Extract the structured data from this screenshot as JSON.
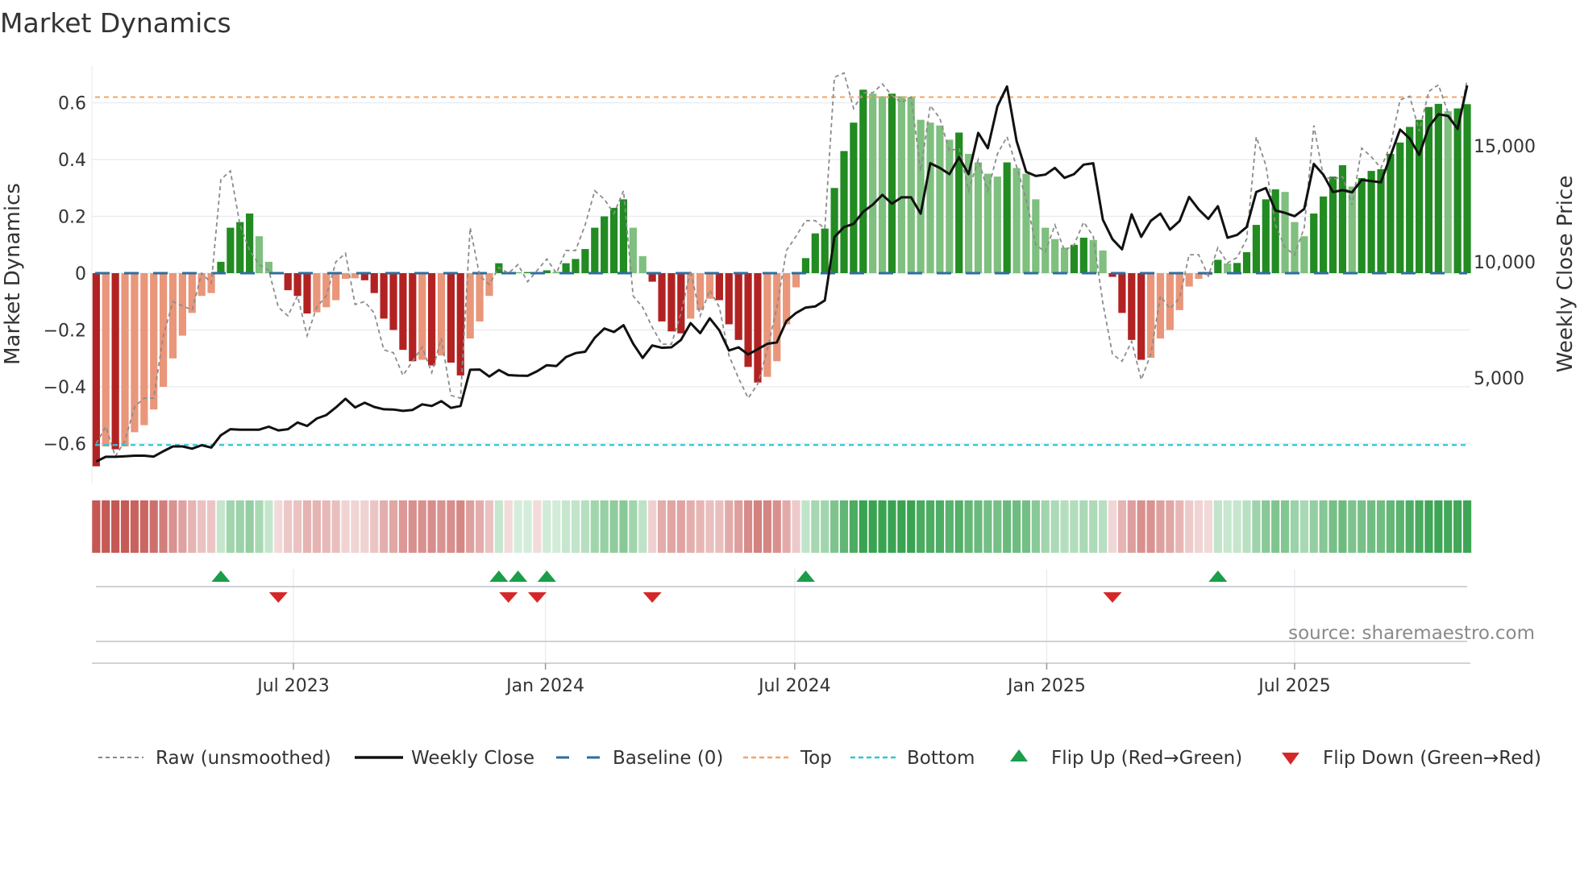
{
  "chart_data": {
    "type": "bar",
    "title": "Market Dynamics",
    "ylabel": "Market Dynamics",
    "y2label": "Weekly Close Price",
    "source": "source: sharemaestro.com",
    "frequency": "weekly",
    "start_week": "2023-02-07",
    "ylim": [
      -0.72,
      0.72
    ],
    "y2lim": [
      0,
      18500
    ],
    "grid": true,
    "legend_position": "bottom",
    "top_level": 0.62,
    "bottom_level": -0.605,
    "baseline_level": 0,
    "y_ticks": [
      {
        "value": 0.6,
        "label": "0.6"
      },
      {
        "value": 0.4,
        "label": "0.4"
      },
      {
        "value": 0.2,
        "label": "0.2"
      },
      {
        "value": 0,
        "label": "0"
      },
      {
        "value": -0.2,
        "label": "−0.2"
      },
      {
        "value": -0.4,
        "label": "−0.4"
      },
      {
        "value": -0.6,
        "label": "−0.6"
      }
    ],
    "y2_ticks": [
      {
        "value": 15000,
        "label": "15,000"
      },
      {
        "value": 10000,
        "label": "10,000"
      },
      {
        "value": 5000,
        "label": "5,000"
      }
    ],
    "x_ticks": [
      {
        "date": "2023-07-01",
        "label": "Jul 2023"
      },
      {
        "date": "2024-01-01",
        "label": "Jan 2024"
      },
      {
        "date": "2024-07-01",
        "label": "Jul 2024"
      },
      {
        "date": "2025-01-01",
        "label": "Jan 2025"
      },
      {
        "date": "2025-07-01",
        "label": "Jul 2025"
      }
    ],
    "legend": [
      {
        "label": "Raw (unsmoothed)",
        "color": "#888888"
      },
      {
        "label": "Weekly Close",
        "color": "#111111"
      },
      {
        "label": "Baseline (0)",
        "color": "#2e6e9e"
      },
      {
        "label": "Top",
        "color": "#f0a56a"
      },
      {
        "label": "Bottom",
        "color": "#2ec7d6"
      },
      {
        "label": "Flip Up (Red→Green)",
        "color": "#1a9e4a"
      },
      {
        "label": "Flip Down (Green→Red)",
        "color": "#d62728"
      }
    ],
    "colors": {
      "strong_pos": "#228b22",
      "weak_pos": "#7fbf7f",
      "strong_neg": "#b22222",
      "weak_neg": "#e9967a"
    },
    "flip_up_weeks": [
      14,
      43,
      45,
      48,
      75,
      118
    ],
    "flip_down_weeks": [
      20,
      44,
      47,
      59,
      107
    ],
    "momentum": [
      -0.68,
      -0.61,
      -0.62,
      -0.61,
      -0.56,
      -0.535,
      -0.48,
      -0.4,
      -0.3,
      -0.22,
      -0.14,
      -0.08,
      -0.07,
      0.04,
      0.16,
      0.18,
      0.21,
      0.13,
      0.04,
      -0.003,
      -0.06,
      -0.08,
      -0.142,
      -0.138,
      -0.12,
      -0.095,
      -0.02,
      -0.018,
      -0.025,
      -0.07,
      -0.16,
      -0.2,
      -0.27,
      -0.31,
      -0.305,
      -0.325,
      -0.29,
      -0.315,
      -0.36,
      -0.23,
      -0.17,
      -0.08,
      0.035,
      -0.002,
      0.002,
      0.004,
      -0.002,
      0.01,
      0.005,
      0.035,
      0.05,
      0.085,
      0.16,
      0.2,
      0.23,
      0.26,
      0.16,
      0.06,
      -0.03,
      -0.17,
      -0.205,
      -0.212,
      -0.16,
      -0.13,
      -0.09,
      -0.095,
      -0.18,
      -0.235,
      -0.33,
      -0.385,
      -0.365,
      -0.31,
      -0.18,
      -0.05,
      0.053,
      0.14,
      0.157,
      0.3,
      0.43,
      0.53,
      0.646,
      0.632,
      0.623,
      0.632,
      0.623,
      0.62,
      0.54,
      0.53,
      0.52,
      0.47,
      0.495,
      0.42,
      0.39,
      0.35,
      0.34,
      0.39,
      0.37,
      0.35,
      0.26,
      0.16,
      0.12,
      0.09,
      0.1,
      0.125,
      0.117,
      0.08,
      -0.013,
      -0.14,
      -0.235,
      -0.305,
      -0.298,
      -0.23,
      -0.2,
      -0.13,
      -0.047,
      -0.02,
      -0.007,
      0.047,
      0.034,
      0.036,
      0.074,
      0.17,
      0.26,
      0.295,
      0.286,
      0.18,
      0.13,
      0.21,
      0.27,
      0.34,
      0.38,
      0.305,
      0.335,
      0.36,
      0.366,
      0.42,
      0.46,
      0.515,
      0.54,
      0.585,
      0.596,
      0.57,
      0.58,
      0.595
    ],
    "raw": [
      -0.6,
      -0.54,
      -0.645,
      -0.59,
      -0.47,
      -0.44,
      -0.44,
      -0.22,
      -0.1,
      -0.115,
      -0.13,
      0.0,
      -0.035,
      0.33,
      0.36,
      0.17,
      0.08,
      0.03,
      0.01,
      -0.12,
      -0.15,
      -0.08,
      -0.22,
      -0.12,
      -0.08,
      0.04,
      0.07,
      -0.11,
      -0.1,
      -0.14,
      -0.27,
      -0.28,
      -0.36,
      -0.31,
      -0.26,
      -0.35,
      -0.23,
      -0.43,
      -0.44,
      0.16,
      -0.01,
      -0.04,
      0.02,
      0.0,
      0.03,
      -0.03,
      0.01,
      0.05,
      0.0,
      0.08,
      0.08,
      0.17,
      0.29,
      0.26,
      0.21,
      0.29,
      -0.08,
      -0.12,
      -0.19,
      -0.25,
      -0.25,
      -0.14,
      0.01,
      -0.15,
      -0.06,
      -0.12,
      -0.29,
      -0.37,
      -0.44,
      -0.39,
      -0.27,
      -0.12,
      0.08,
      0.13,
      0.185,
      0.185,
      0.157,
      0.69,
      0.705,
      0.58,
      0.635,
      0.635,
      0.666,
      0.625,
      0.6,
      0.62,
      0.36,
      0.59,
      0.545,
      0.43,
      0.44,
      0.29,
      0.4,
      0.29,
      0.42,
      0.48,
      0.375,
      0.26,
      0.1,
      0.075,
      0.17,
      0.08,
      0.1,
      0.18,
      0.13,
      -0.105,
      -0.285,
      -0.31,
      -0.24,
      -0.375,
      -0.285,
      -0.08,
      -0.125,
      -0.087,
      0.065,
      0.065,
      -0.01,
      0.09,
      0.036,
      0.055,
      0.12,
      0.48,
      0.38,
      0.17,
      0.09,
      0.064,
      0.16,
      0.52,
      0.34,
      0.33,
      0.34,
      0.24,
      0.44,
      0.41,
      0.37,
      0.45,
      0.61,
      0.623,
      0.5,
      0.64,
      0.663,
      0.565,
      0.51,
      0.68
    ],
    "weekly_close": [
      1400,
      1600,
      1600,
      1620,
      1650,
      1650,
      1610,
      1840,
      2050,
      2050,
      1950,
      2100,
      2000,
      2530,
      2790,
      2770,
      2770,
      2770,
      2900,
      2740,
      2790,
      3080,
      2930,
      3250,
      3400,
      3730,
      4100,
      3730,
      3930,
      3750,
      3650,
      3640,
      3580,
      3620,
      3860,
      3790,
      4000,
      3710,
      3790,
      5350,
      5360,
      5060,
      5340,
      5120,
      5100,
      5090,
      5290,
      5550,
      5510,
      5900,
      6070,
      6130,
      6730,
      7130,
      6980,
      7270,
      6480,
      5860,
      6400,
      6300,
      6320,
      6640,
      7360,
      6930,
      7570,
      7050,
      6180,
      6320,
      6010,
      6240,
      6470,
      6530,
      7450,
      7800,
      8030,
      8080,
      8340,
      11070,
      11500,
      11640,
      12160,
      12470,
      12890,
      12510,
      12780,
      12780,
      12080,
      14250,
      14050,
      13780,
      14510,
      13780,
      15560,
      14900,
      16710,
      17560,
      15210,
      13880,
      13700,
      13760,
      14050,
      13620,
      13780,
      14190,
      14250,
      11820,
      10980,
      10540,
      12050,
      11080,
      11770,
      12080,
      11390,
      11760,
      12800,
      12260,
      11850,
      12400,
      11040,
      11160,
      11500,
      13010,
      13180,
      12220,
      12110,
      11970,
      12280,
      14220,
      13760,
      13010,
      13090,
      13000,
      13530,
      13480,
      13430,
      14570,
      15700,
      15320,
      14610,
      15820,
      16360,
      16290,
      15730,
      17600
    ]
  }
}
